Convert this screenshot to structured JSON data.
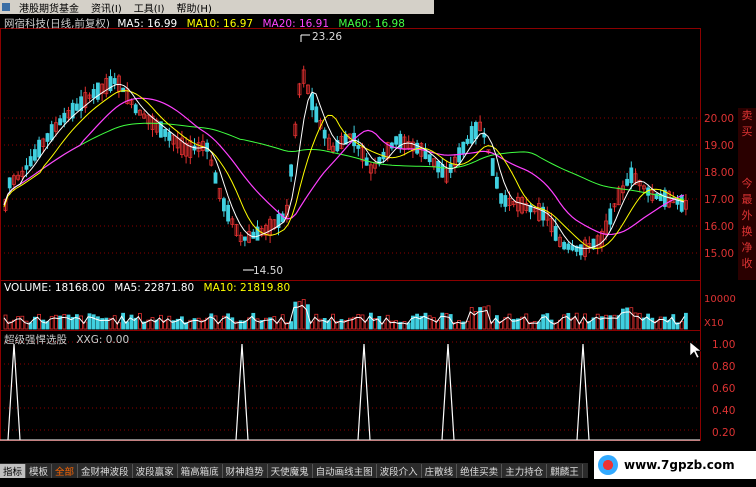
{
  "menu": {
    "items": [
      "港股期货基金",
      "资讯(I)",
      "工具(I)",
      "帮助(H)"
    ]
  },
  "header": {
    "stock": "网宿科技(日线,前复权)",
    "ma5": "MA5: 16.99",
    "ma10": "MA10: 16.97",
    "ma20": "MA20: 16.91",
    "ma60": "MA60: 16.98"
  },
  "volume_header": {
    "vol": "VOLUME: 18168.00",
    "ma5": "MA5: 22871.80",
    "ma10": "MA10: 21819.80"
  },
  "indicator_header": {
    "name": "超级强悍选股",
    "value": "XXG: 0.00"
  },
  "annotations": {
    "high": "23.26",
    "low": "14.50"
  },
  "price_ticks": [
    "20.00",
    "19.00",
    "18.00",
    "17.00",
    "16.00",
    "15.00"
  ],
  "volume_ticks": [
    "10000",
    "X10"
  ],
  "indicator_ticks": [
    "1.00",
    "0.80",
    "0.60",
    "0.40",
    "0.20"
  ],
  "right_strip": [
    "卖",
    "买",
    "今",
    "最",
    "外",
    "换",
    "净",
    "收"
  ],
  "tabs": [
    "指标",
    "模板",
    "全部",
    "金财神波段",
    "波段赢家",
    "箱高箱底",
    "财神趋势",
    "天使魔鬼",
    "自动画线主图",
    "波段介入",
    "庄散线",
    "绝佳买卖",
    "主力持仓",
    "麒麟王"
  ],
  "watermark": "www.7gpzb.com",
  "colors": {
    "up": "#e03030",
    "down": "#40d0e0",
    "ma5": "#ffffff",
    "ma10": "#ffff00",
    "ma20": "#ff40ff",
    "ma60": "#40ff40",
    "grid": "#8b0000"
  }
}
